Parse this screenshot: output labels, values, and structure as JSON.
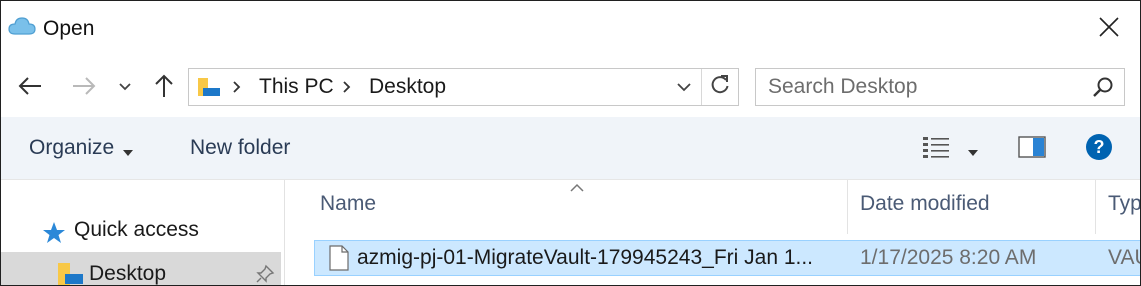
{
  "window": {
    "title": "Open"
  },
  "address_bar": {
    "crumbs": [
      "This PC",
      "Desktop"
    ]
  },
  "search": {
    "placeholder": "Search Desktop"
  },
  "command_bar": {
    "organize_label": "Organize",
    "new_folder_label": "New folder"
  },
  "nav_pane": {
    "quick_access_label": "Quick access",
    "desktop_label": "Desktop"
  },
  "file_list": {
    "columns": [
      "Name",
      "Date modified",
      "Typ"
    ],
    "rows": [
      {
        "name": "azmig-pj-01-MigrateVault-179945243_Fri Jan 1...",
        "date_modified": "1/17/2025 8:20 AM",
        "type": "VAU"
      }
    ]
  },
  "icons": {
    "app": "cloud-icon",
    "back": "back-arrow-icon",
    "forward": "forward-arrow-icon",
    "recent": "chevron-down-icon",
    "up": "up-arrow-icon",
    "refresh": "refresh-icon",
    "search": "search-icon",
    "view": "details-view-icon",
    "preview_pane": "preview-pane-icon",
    "help": "help-icon",
    "pin": "pin-icon"
  },
  "colors": {
    "command_bar_bg": "#f0f4f9",
    "selection_bg": "#cce8ff",
    "selection_border": "#99d1ff",
    "help_blue": "#0063b1",
    "folder_yellow": "#f8c847"
  }
}
